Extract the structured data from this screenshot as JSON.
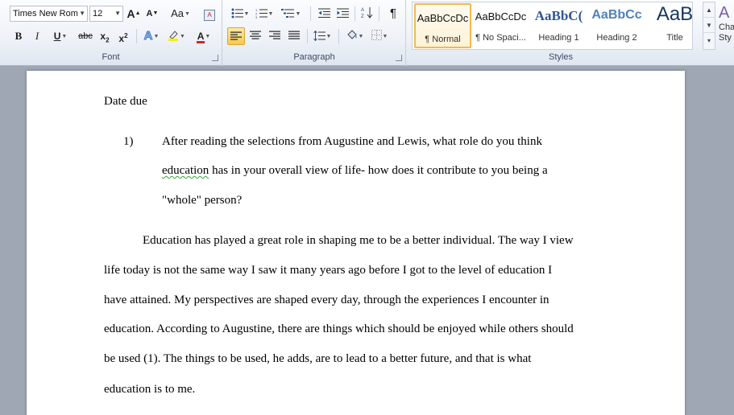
{
  "ribbon": {
    "font": {
      "group_label": "Font",
      "font_name": "Times New Rom",
      "font_size": "12",
      "grow_font": "A",
      "shrink_font": "A",
      "change_case": "Aa",
      "bold": "B",
      "italic": "I",
      "underline": "U",
      "strikethrough": "abc",
      "subscript_base": "x",
      "subscript_mark": "2",
      "superscript_base": "x",
      "superscript_mark": "2",
      "text_effects": "A",
      "font_color": "A"
    },
    "paragraph": {
      "group_label": "Paragraph",
      "pilcrow": "¶"
    },
    "styles": {
      "group_label": "Styles",
      "items": [
        {
          "preview": "AaBbCcDc",
          "name": "¶ Normal",
          "selected": true
        },
        {
          "preview": "AaBbCcDc",
          "name": "¶ No Spaci...",
          "selected": false
        },
        {
          "preview": "AaBbC(",
          "name": "Heading 1",
          "selected": false
        },
        {
          "preview": "AaBbCc",
          "name": "Heading 2",
          "selected": false
        },
        {
          "preview": "AaB",
          "name": "Title",
          "selected": false
        }
      ],
      "change_styles_label": "Cha Sty",
      "change_styles_line1": "Cha",
      "change_styles_line2": "Sty"
    }
  },
  "document": {
    "heading": "Date due",
    "question": {
      "number": "1)",
      "lines": [
        "After reading the selections from Augustine and Lewis, what role do you think",
        "has in your overall view of life- how does it contribute to you being a",
        "\"whole\" person?"
      ],
      "flagged_word": "education"
    },
    "paragraph_lines": [
      "Education has played a great role in shaping me to be a better individual. The way I view",
      "life today is not the same way I saw it many years ago before I got to the level  of education I",
      "have attained. My perspectives are shaped every day, through the experiences  I encounter in",
      "education. According to Augustine, there are things which should be enjoyed while others should",
      "be used (1). The things to be used, he adds, are to lead to a better future, and that is what",
      "education is to me."
    ]
  }
}
